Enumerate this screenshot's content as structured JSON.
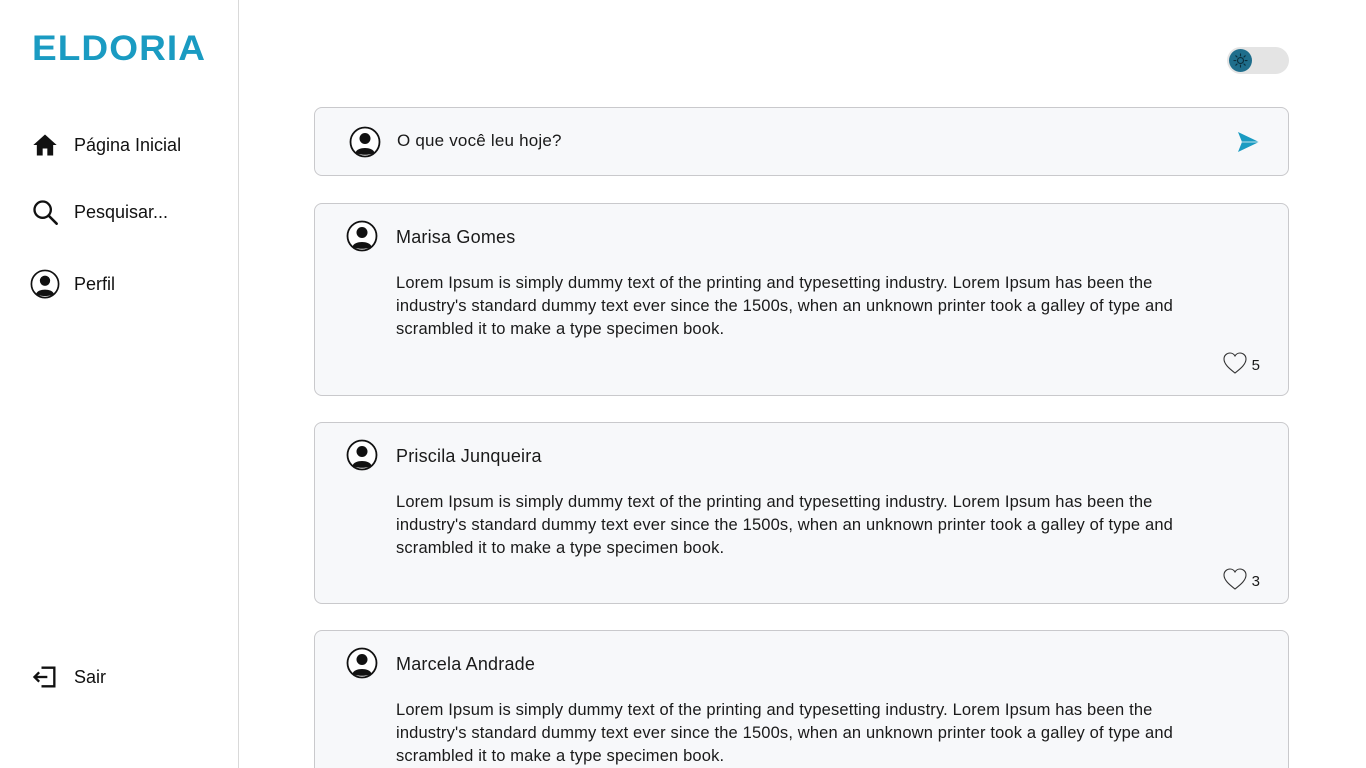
{
  "app": {
    "logo_text": "ELDORIA",
    "accent_color": "#1a9bc2"
  },
  "sidebar": {
    "items": [
      {
        "label": "Página Inicial",
        "icon": "home-icon"
      },
      {
        "label": "Pesquisar...",
        "icon": "search-icon"
      },
      {
        "label": "Perfil",
        "icon": "user-circle-icon"
      }
    ],
    "logout": {
      "label": "Sair",
      "icon": "logout-icon"
    }
  },
  "header": {
    "theme_toggle": {
      "icon": "sun-icon",
      "state": "light"
    }
  },
  "composer": {
    "placeholder": "O que você leu hoje?",
    "send_icon": "send-icon"
  },
  "posts": [
    {
      "author": "Marisa Gomes",
      "text": "Lorem Ipsum is simply dummy text of the printing and typesetting industry. Lorem Ipsum has been the industry's standard dummy text ever since the 1500s, when an unknown printer took a galley of type and scrambled it to make a type specimen book.",
      "likes": "5"
    },
    {
      "author": "Priscila Junqueira",
      "text": "Lorem Ipsum is simply dummy text of the printing and typesetting industry. Lorem Ipsum has been the industry's standard dummy text ever since the 1500s, when an unknown printer took a galley of type and scrambled it to make a type specimen book.",
      "likes": "3"
    },
    {
      "author": "Marcela Andrade",
      "text": "Lorem Ipsum is simply dummy text of the printing and typesetting industry. Lorem Ipsum has been the industry's standard dummy text ever since the 1500s, when an unknown printer took a galley of type and scrambled it to make a type specimen book."
    }
  ]
}
